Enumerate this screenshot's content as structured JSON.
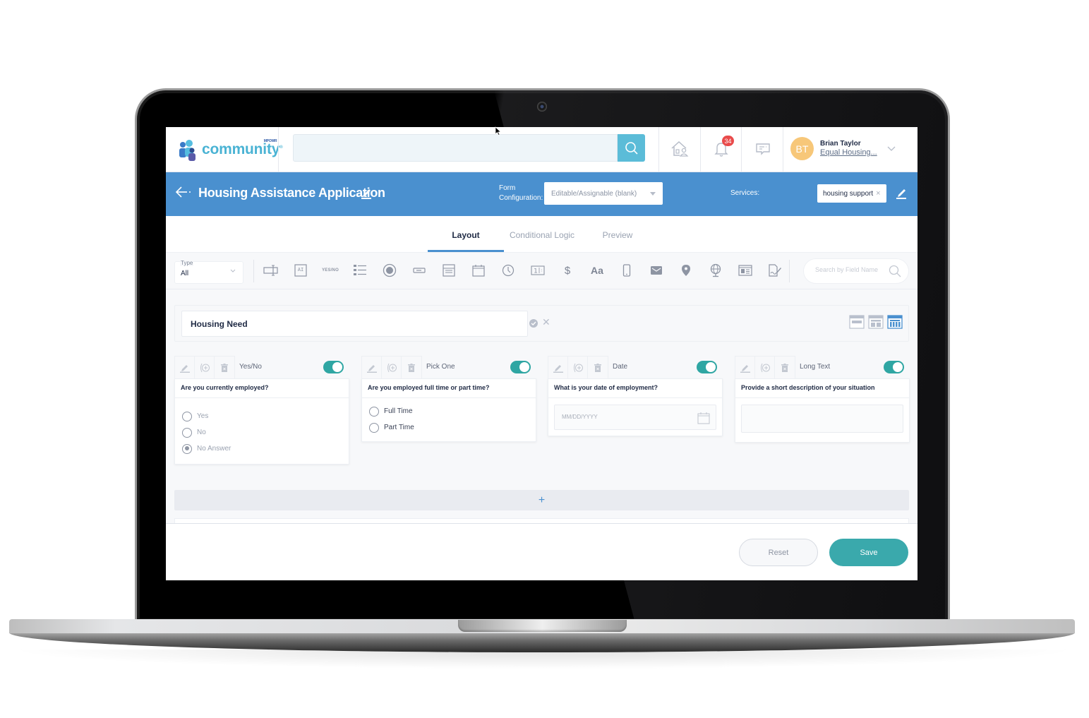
{
  "app": {
    "logo_text": "community",
    "logo_small": "MPOWR"
  },
  "topbar": {
    "search_placeholder": "",
    "search_icon": "search-icon",
    "icons": [
      "home-people-icon",
      "bell-icon",
      "chat-icon"
    ],
    "notification_count": "34",
    "user": {
      "initials": "BT",
      "name": "Brian Taylor",
      "org": "Equal Housing...",
      "avatar_color": "#f7c779"
    }
  },
  "header": {
    "title": "Housing Assistance Application",
    "config_label_line1": "Form",
    "config_label_line2": "Configuration:",
    "config_value": "Editable/Assignable (blank)",
    "services_label": "Services:",
    "service_chip": "housing support",
    "chip_remove": "×",
    "color": "#4a90cf"
  },
  "tabs": [
    {
      "label": "Layout",
      "active": true
    },
    {
      "label": "Conditional Logic",
      "active": false
    },
    {
      "label": "Preview",
      "active": false
    }
  ],
  "toolbar": {
    "type_label": "Type",
    "type_value": "All",
    "tools": [
      "text-field-icon",
      "ai-field-icon",
      "yes-no-icon",
      "checklist-icon",
      "radio-icon",
      "short-input-icon",
      "form-block-icon",
      "date-icon",
      "time-icon",
      "number-icon",
      "currency-icon",
      "text-style-icon",
      "phone-icon",
      "email-icon",
      "location-icon",
      "web-icon",
      "id-card-icon",
      "signature-icon"
    ],
    "yesno_text": "YES/NO",
    "aa_text": "Aa",
    "dollar_text": "$",
    "search_placeholder": "Search by Field Name"
  },
  "section": {
    "title": "Housing Need",
    "layouts": [
      "one-column-layout",
      "two-column-layout",
      "four-column-layout"
    ],
    "active_layout": "four-column-layout"
  },
  "fields": [
    {
      "type": "Yes/No",
      "question": "Are you currently employed?",
      "enabled": true,
      "options": [
        {
          "label": "Yes",
          "checked": false
        },
        {
          "label": "No",
          "checked": false
        },
        {
          "label": "No Answer",
          "checked": true
        }
      ]
    },
    {
      "type": "Pick One",
      "question": "Are you employed full time or part time?",
      "enabled": true,
      "options": [
        {
          "label": "Full Time",
          "checked": false
        },
        {
          "label": "Part Time",
          "checked": false
        }
      ]
    },
    {
      "type": "Date",
      "question": "What is your date of employment?",
      "enabled": true,
      "placeholder": "MM/DD/YYYY"
    },
    {
      "type": "Long Text",
      "question": "Provide a short description of your situation",
      "enabled": true
    }
  ],
  "add_row": "+",
  "footer": {
    "reset_label": "Reset",
    "save_label": "Save",
    "save_color": "#3aa9ac"
  }
}
